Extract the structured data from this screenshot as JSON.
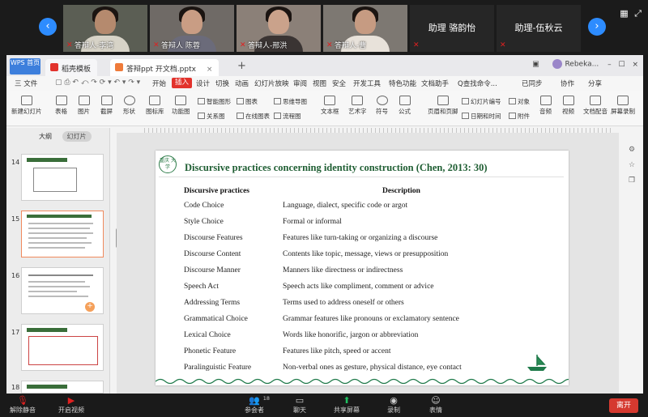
{
  "gallery": {
    "participants": [
      {
        "name": "答辩人-李湾"
      },
      {
        "name": "答辩人 陈蓉"
      },
      {
        "name": "答辩人-邢洪"
      },
      {
        "name": "答辩人-曹"
      }
    ],
    "assistants": [
      {
        "name": "助理 骆韵怡"
      },
      {
        "name": "助理-伍秋云"
      }
    ],
    "nav_prev": "‹",
    "nav_next": "›"
  },
  "wps": {
    "home_tab": "WPS 首页",
    "tabs": [
      {
        "label": "稻壳模板",
        "color": "#e2322c"
      },
      {
        "label": "答辩ppt 开文档.pptx",
        "color": "#ef7b3a"
      }
    ],
    "user_name": "Rebeka...",
    "menu": {
      "file": "三 文件",
      "items": [
        "开始",
        "插入",
        "设计",
        "切换",
        "动画",
        "幻灯片放映",
        "审阅",
        "视图",
        "安全",
        "开发工具",
        "特色功能",
        "文档助手"
      ],
      "active": "插入",
      "search": "Q查找命令...",
      "sync": "已同步",
      "collab": "协作",
      "share": "分享"
    },
    "ribbon": {
      "big": [
        "新建幻灯片",
        "表格",
        "图片",
        "截屏",
        "形状",
        "图标库",
        "功能图",
        "文本框",
        "艺术字",
        "符号",
        "公式",
        "页眉和页脚",
        "音频",
        "视频",
        "文档配音",
        "屏幕录制"
      ],
      "small": [
        "智能图形",
        "图表",
        "思维导图",
        "关系图",
        "在线图表",
        "流程图",
        "幻灯片编号",
        "对象",
        "日期和时间",
        "附件"
      ]
    },
    "panel": {
      "tab_outline": "大纲",
      "tab_slides": "幻灯片",
      "slide_numbers": [
        "14",
        "15",
        "16",
        "17",
        "18"
      ]
    }
  },
  "slide": {
    "logo_text": "重庆 大学",
    "title": "Discursive practices concerning identity construction (Chen, 2013: 30)",
    "header_left": "Discursive practices",
    "header_right": "Description",
    "rows": [
      {
        "practice": "Code Choice",
        "description": "Language, dialect, specific code or argot"
      },
      {
        "practice": "Style Choice",
        "description": "Formal or informal"
      },
      {
        "practice": "Discourse Features",
        "description": "Features like turn-taking or organizing a discourse"
      },
      {
        "practice": "Discourse Content",
        "description": "Contents like topic, message, views or presupposition"
      },
      {
        "practice": "Discourse Manner",
        "description": "Manners like directness or indirectness"
      },
      {
        "practice": "Speech Act",
        "description": "Speech acts like compliment, comment or advice"
      },
      {
        "practice": "Addressing Terms",
        "description": "Terms used to address oneself or others"
      },
      {
        "practice": "Grammatical Choice",
        "description": "Grammar features like pronouns or exclamatory sentence"
      },
      {
        "practice": "Lexical Choice",
        "description": "Words like honorific, jargon or abbreviation"
      },
      {
        "practice": "Phonetic Feature",
        "description": "Features like pitch, speed or accent"
      },
      {
        "practice": "Paralinguistic Feature",
        "description": "Non-verbal ones as gesture, physical distance, eye contact"
      }
    ]
  },
  "zoom_bar": {
    "unmute": "解除静音",
    "start_video": "开启视频",
    "participants": "参会者",
    "participants_count": "18",
    "chat": "聊天",
    "share_screen": "共享屏幕",
    "record": "录制",
    "reactions": "表情",
    "leave": "离开"
  }
}
